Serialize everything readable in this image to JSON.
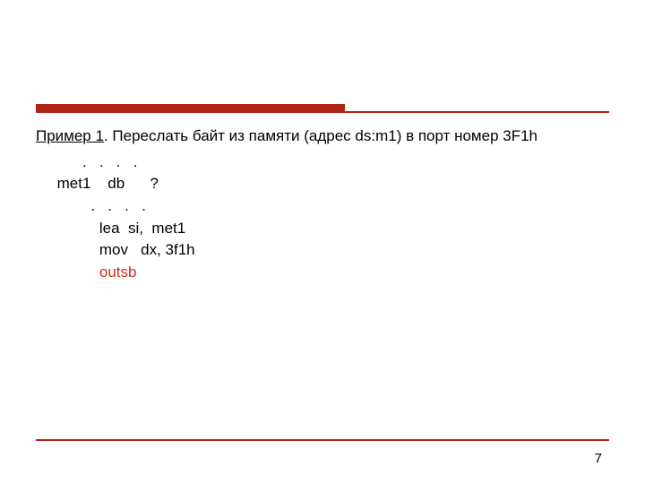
{
  "header": {
    "example_label": "Пример 1",
    "period": ".",
    "description": "   Переслать байт из памяти (адрес  ds:m1)  в порт номер 3F1h"
  },
  "code": {
    "l1": "           .   .   .   .",
    "l2": "     met1    db      ?",
    "l3": "             .   .   .   .",
    "l4": "               lea  si,  met1",
    "l5": "               mov   dx, 3f1h",
    "l6_indent": "               ",
    "l6_instr": "outsb"
  },
  "page_number": "7"
}
